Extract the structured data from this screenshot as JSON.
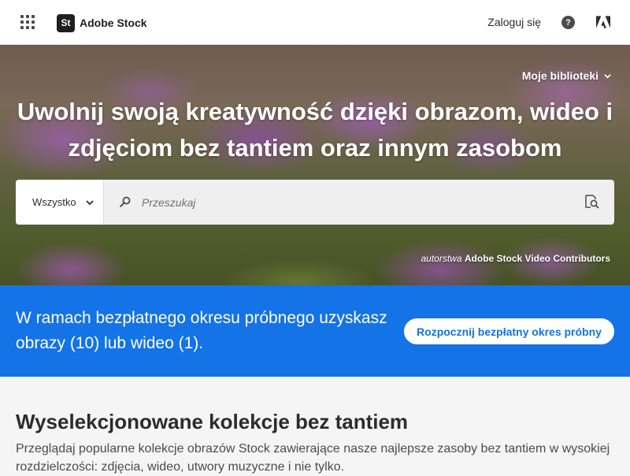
{
  "header": {
    "apps_icon": "app-grid-icon",
    "logo_text": "St",
    "brand_name": "Adobe Stock",
    "signin_label": "Zaloguj się",
    "help_glyph": "?",
    "adobe_icon": "adobe-logo-icon"
  },
  "hero": {
    "libraries_label": "Moje biblioteki",
    "title": "Uwolnij swoją kreatywność dzięki obrazom, wideo i zdjęciom bez tantiem oraz innym zasobom",
    "search": {
      "scope_label": "Wszystko",
      "placeholder": "Przeszukaj",
      "value": ""
    },
    "credit_by": "autorstwa",
    "credit_author": "Adobe Stock Video Contributors"
  },
  "trial": {
    "text": "W ramach bezpłatnego okresu próbnego uzyskasz obrazy (10) lub wideo (1).",
    "button_label": "Rozpocznij bezpłatny okres próbny",
    "bg_color": "#1473e6"
  },
  "collections": {
    "title": "Wyselekcjonowane kolekcje bez tantiem",
    "description": "Przeglądaj popularne kolekcje obrazów Stock zawierające nasze najlepsze zasoby bez tantiem w wysokiej rozdzielczości: zdjęcia, wideo, utwory muzyczne i nie tylko."
  }
}
